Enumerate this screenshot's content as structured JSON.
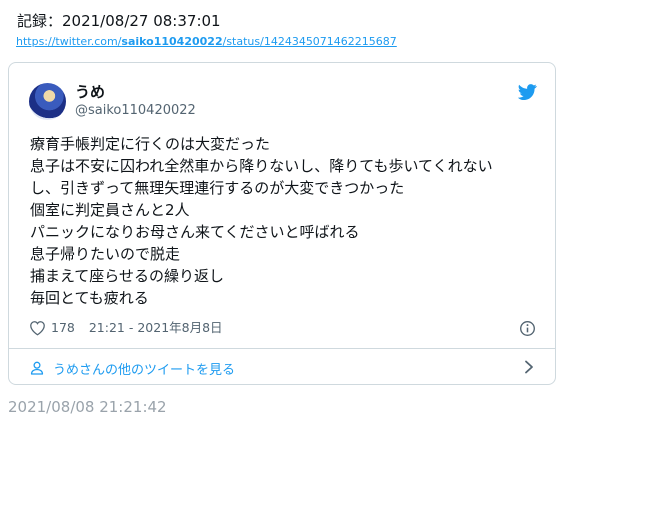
{
  "record": {
    "text": "記録：2021/08/27 08:37:01"
  },
  "url": {
    "prefix": "https://twitter.com/",
    "user": "saiko110420022",
    "suffix": "/status/1424345071462215687"
  },
  "tweet": {
    "name": "うめ",
    "handle": "@saiko110420022",
    "lines": [
      "療育手帳判定に行くのは大変だった",
      "息子は不安に囚われ全然車から降りないし、降りても歩いてくれない",
      "し、引きずって無理矢理連行するのが大変できつかった",
      "個室に判定員さんと2人",
      "パニックになりお母さん来てくださいと呼ばれる",
      "息子帰りたいので脱走",
      "捕まえて座らせるの繰り返し",
      "毎回とても疲れる"
    ],
    "likes": "178",
    "timestamp": "21:21 - 2021年8月8日",
    "more_link": "うめさんの他のツイートを見る"
  },
  "footer_time": "2021/08/08 21:21:42",
  "colors": {
    "accent": "#1d9bf0",
    "muted": "#536471",
    "border": "#cfd9de"
  }
}
